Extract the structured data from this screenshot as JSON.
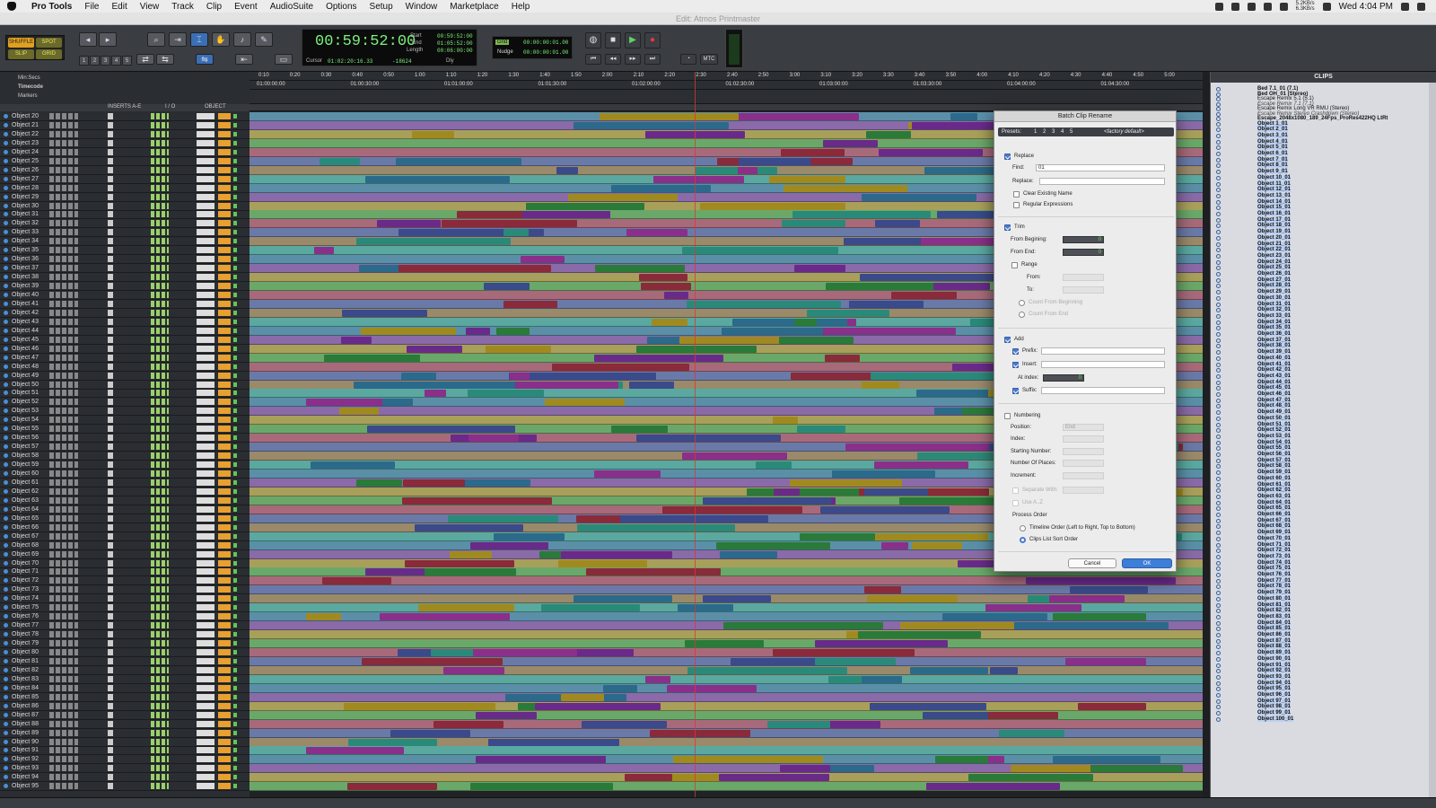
{
  "menubar": {
    "app": "Pro Tools",
    "items": [
      "File",
      "Edit",
      "View",
      "Track",
      "Clip",
      "Event",
      "AudioSuite",
      "Options",
      "Setup",
      "Window",
      "Marketplace",
      "Help"
    ],
    "net_up": "5.2KB/s",
    "net_down": "6.3KB/s",
    "clock": "Wed 4:04 PM"
  },
  "window_title": "Edit: Atmos Printmaster",
  "toolbar": {
    "modes": [
      "SHUFFLE",
      "SPOT",
      "SLIP",
      "GRID"
    ],
    "counter_main": "00:59:52:00",
    "start_label": "Start",
    "start_value": "00:59:52:00",
    "end_label": "End",
    "end_value": "01:05:52:00",
    "length_label": "Length",
    "length_value": "00:06:00:00",
    "cursor_label": "Cursor",
    "cursor_value": "01:02:20:16.33",
    "cursor_offset": "-18624",
    "dly_label": "Dly",
    "grid_label": "Grid",
    "grid_value": "00:00:00:01.00",
    "nudge_label": "Nudge",
    "nudge_value": "00:00:00:01.00",
    "mtc_label": "MTC",
    "zoom_presets": [
      "1",
      "2",
      "3",
      "4",
      "5"
    ]
  },
  "rulers": {
    "minsecs_label": "Min:Secs",
    "timecode_label": "Timecode",
    "markers_label": "Markers",
    "minsecs_ticks": [
      "0:10",
      "0:20",
      "0:30",
      "0:40",
      "0:50",
      "1:00",
      "1:10",
      "1:20",
      "1:30",
      "1:40",
      "1:50",
      "2:00",
      "2:10",
      "2:20",
      "2:30",
      "2:40",
      "2:50",
      "3:00",
      "3:10",
      "3:20",
      "3:30",
      "3:40",
      "3:50",
      "4:00",
      "4:10",
      "4:20",
      "4:30",
      "4:40",
      "4:50",
      "5:00"
    ],
    "timecode_ticks": [
      "01:00:00:00",
      "01:00:30:00",
      "01:01:00:00",
      "01:01:30:00",
      "01:02:00:00",
      "01:02:30:00",
      "01:03:00:00",
      "01:03:30:00",
      "01:04:00:00",
      "01:04:30:00"
    ]
  },
  "track_columns": {
    "inserts": "INSERTS A-E",
    "io": "I / O",
    "object": "OBJECT"
  },
  "tracks": [
    "Object 20",
    "Object 21",
    "Object 22",
    "Object 23",
    "Object 24",
    "Object 25",
    "Object 26",
    "Object 27",
    "Object 28",
    "Object 29",
    "Object 30",
    "Object 31",
    "Object 32",
    "Object 33",
    "Object 34",
    "Object 35",
    "Object 36",
    "Object 37",
    "Object 38",
    "Object 39",
    "Object 40",
    "Object 41",
    "Object 42",
    "Object 43",
    "Object 44",
    "Object 45",
    "Object 46",
    "Object 47",
    "Object 48",
    "Object 49",
    "Object 50",
    "Object 51",
    "Object 52",
    "Object 53",
    "Object 54",
    "Object 55",
    "Object 56",
    "Object 57",
    "Object 58",
    "Object 59",
    "Object 60",
    "Object 61",
    "Object 62",
    "Object 63",
    "Object 64",
    "Object 65",
    "Object 66",
    "Object 67",
    "Object 68",
    "Object 69",
    "Object 70",
    "Object 71",
    "Object 72",
    "Object 73",
    "Object 74",
    "Object 75",
    "Object 76",
    "Object 77",
    "Object 78",
    "Object 79",
    "Object 80",
    "Object 81",
    "Object 82",
    "Object 83",
    "Object 84",
    "Object 85",
    "Object 86",
    "Object 87",
    "Object 88",
    "Object 89",
    "Object 90",
    "Object 91",
    "Object 92",
    "Object 93",
    "Object 94",
    "Object 95"
  ],
  "clips": {
    "title": "CLIPS",
    "header_items": [
      {
        "label": "Bed 7.1_01 (7.1)",
        "style": "bold"
      },
      {
        "label": "Bed OH_01 (Stereo)",
        "style": "bold"
      },
      {
        "label": "Escape Remix 5.1 (5.1)",
        "style": "normal"
      },
      {
        "label": "Escape Remix 7.1 (7.1)",
        "style": "italic"
      },
      {
        "label": "Escape Remix Long VR RMU (Stereo)",
        "style": "normal"
      },
      {
        "label": "Escape Remix Stereo Crashdown (Stereo)",
        "style": "italic"
      },
      {
        "label": "Escape_2048x1080_189_24Fps_ProRes422HQ LtRt",
        "style": "bold"
      }
    ],
    "objects_from": 1,
    "objects_to": 100
  },
  "dialog": {
    "title": "Batch Clip Rename",
    "presets_label": "Presets:",
    "preset_numbers": [
      "1",
      "2",
      "3",
      "4",
      "5"
    ],
    "preset_value": "<factory default>",
    "replace_label": "Replace",
    "find_label": "Find:",
    "find_value": "01",
    "replace_field_label": "Replace:",
    "replace_value": "",
    "clear_existing": "Clear Existing Name",
    "regex": "Regular Expressions",
    "trim_label": "Trim",
    "from_beginning": "From Begining:",
    "from_beginning_value": "0",
    "from_end": "From End:",
    "from_end_value": "0",
    "range_label": "Range",
    "range_from": "From:",
    "range_to": "To:",
    "count_from_beginning": "Count From Beginning",
    "count_from_end": "Count From End",
    "add_label": "Add",
    "prefix": "Prefix:",
    "insert": "Insert:",
    "at_index": "At index:",
    "at_index_value": "0",
    "suffix": "Suffix:",
    "numbering_label": "Numbering",
    "position": "Position:",
    "position_value": "End",
    "index": "Index:",
    "starting_number": "Starting Number:",
    "number_of_places": "Number Of Places:",
    "increment": "Increment:",
    "separate_with": "Separate With:",
    "use_az": "Use A..Z",
    "process_order": "Process Order",
    "timeline_order": "Timeline Order (Left to Right, Top to Bottom)",
    "clips_list_order": "Clips List Sort Order",
    "cancel": "Cancel",
    "ok": "OK"
  },
  "colors": {
    "accent": "#3a6fb6",
    "counter_green": "#7cf07c",
    "dialog_ok": "#3d7ed8",
    "clip_colors": [
      "#8a2f8a",
      "#2b6a8a",
      "#a08a20",
      "#2a7a3a",
      "#6a2a8a",
      "#8a2a3a",
      "#3a4a8a",
      "#2a8a7a"
    ]
  }
}
